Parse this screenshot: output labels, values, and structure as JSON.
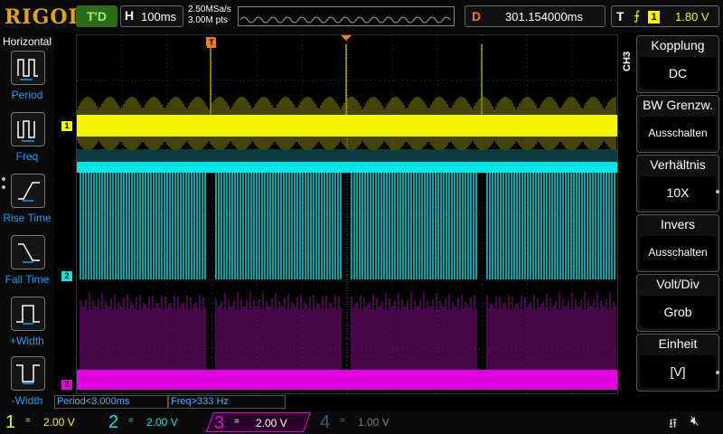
{
  "topbar": {
    "logo": "RIGOL",
    "run_status": "T'D",
    "horizontal_letter": "H",
    "timebase": "100ms",
    "sample_rate": "2.50MSa/s",
    "memory_depth": "3.00M pts",
    "trigger_pos_marker": "T",
    "delay_letter": "D",
    "delay_value": "301.154000ms",
    "trigger_letter": "T",
    "trigger_edge_icon": "rising-edge-icon",
    "trigger_source": "1",
    "trigger_level": "1.80 V"
  },
  "left_menu": {
    "title": "Horizontal",
    "items": [
      {
        "label": "Period",
        "icon": "period-icon"
      },
      {
        "label": "Freq",
        "icon": "frequency-icon"
      },
      {
        "label": "Rise Time",
        "icon": "rise-time-icon"
      },
      {
        "label": "Fall Time",
        "icon": "fall-time-icon"
      },
      {
        "label": "+Width",
        "icon": "positive-width-icon"
      },
      {
        "label": "-Width",
        "icon": "negative-width-icon"
      }
    ]
  },
  "right_menu": {
    "channel_tag": "CH3",
    "items": [
      {
        "label": "Kopplung",
        "value": "DC",
        "has_arrow": true
      },
      {
        "label": "BW Grenzw.",
        "value": "Ausschalten",
        "has_arrow": false
      },
      {
        "label": "Verhältnis",
        "value": "10X",
        "has_arrow": true
      },
      {
        "label": "Invers",
        "value": "Ausschalten",
        "has_arrow": false
      },
      {
        "label": "Volt/Div",
        "value": "Grob",
        "has_arrow": false
      },
      {
        "label": "Einheit",
        "value": "[V]",
        "has_arrow": true
      }
    ]
  },
  "screen": {
    "channel_markers": [
      "1",
      "2",
      "3"
    ],
    "trigger_marker": "T",
    "colors": {
      "ch1": "#f5f500",
      "ch2": "#00e6e6",
      "ch3": "#e000e0",
      "ch4": "#3a5a78",
      "trigger": "#f07d1e",
      "measure": "#4ab0ff"
    }
  },
  "measurements": [
    {
      "text": "Period<3.000ms"
    },
    {
      "text": "Freq>333 Hz"
    }
  ],
  "channels": [
    {
      "num": "1",
      "coupling": "=",
      "scale": "2.00 V",
      "color": "#f5f500",
      "active": false
    },
    {
      "num": "2",
      "coupling": "=",
      "scale": "2.00 V",
      "color": "#00e6e6",
      "active": false
    },
    {
      "num": "3",
      "coupling": "=",
      "scale": "2.00 V",
      "color": "#e000e0",
      "active": true
    },
    {
      "num": "4",
      "coupling": "=",
      "scale": "1.00 V",
      "color": "#3a5a78",
      "active": false
    }
  ],
  "status_icons": {
    "usb": "usb-icon",
    "speaker": "speaker-muted-icon"
  }
}
